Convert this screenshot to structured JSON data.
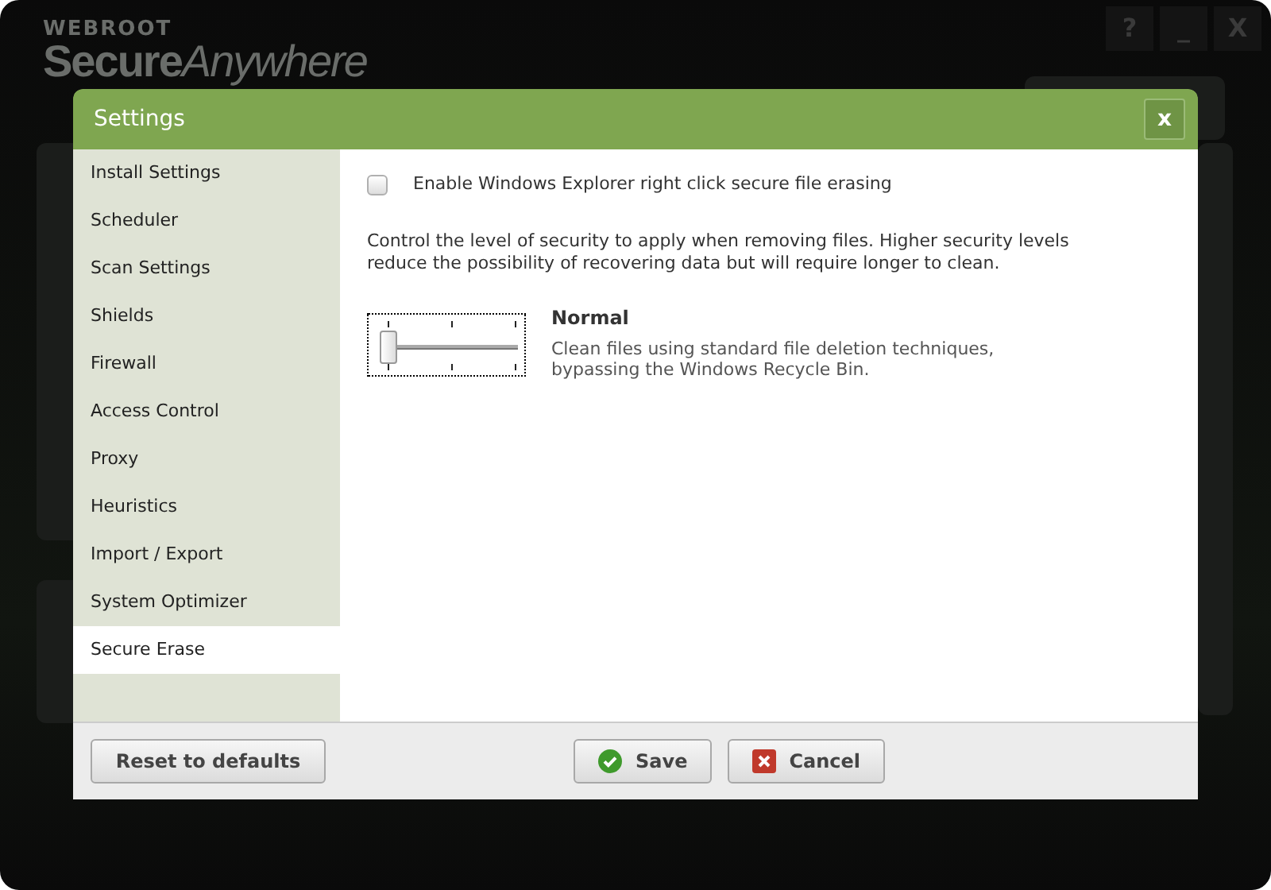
{
  "app": {
    "brand": "WEBROOT",
    "product_bold": "Secure",
    "product_light": "Anywhere",
    "window_buttons": [
      "?",
      "_",
      "X"
    ]
  },
  "dialog": {
    "title": "Settings",
    "close": "x",
    "sidebar": [
      {
        "label": "Install Settings",
        "selected": false
      },
      {
        "label": "Scheduler",
        "selected": false
      },
      {
        "label": "Scan Settings",
        "selected": false
      },
      {
        "label": "Shields",
        "selected": false
      },
      {
        "label": "Firewall",
        "selected": false
      },
      {
        "label": "Access Control",
        "selected": false
      },
      {
        "label": "Proxy",
        "selected": false
      },
      {
        "label": "Heuristics",
        "selected": false
      },
      {
        "label": "Import / Export",
        "selected": false
      },
      {
        "label": "System Optimizer",
        "selected": false
      },
      {
        "label": "Secure Erase",
        "selected": true
      }
    ],
    "option": {
      "label": "Enable Windows Explorer right click secure file erasing",
      "checked": false
    },
    "description": "Control the level of security to apply when removing files. Higher security levels reduce the possibility of recovering data but will require longer to clean.",
    "slider": {
      "level": 0
    },
    "level_title": "Normal",
    "level_description": "Clean files using standard file deletion techniques, bypassing the Windows Recycle Bin.",
    "buttons": [
      {
        "label": "Reset to defaults",
        "kind": "reset"
      },
      {
        "label": "Save",
        "kind": "save"
      },
      {
        "label": "Cancel",
        "kind": "cancel"
      }
    ]
  }
}
